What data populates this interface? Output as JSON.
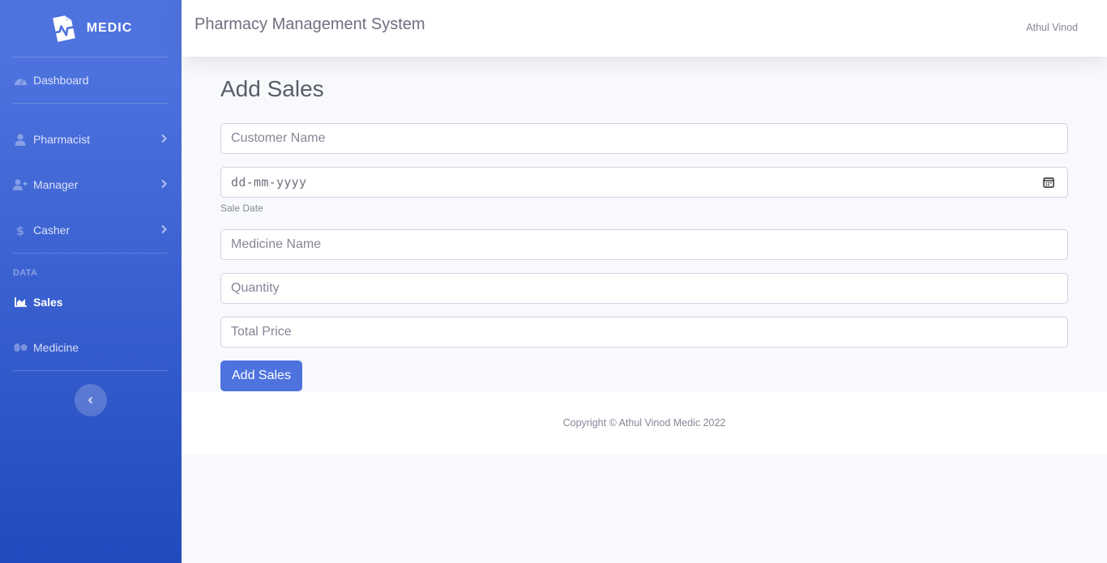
{
  "brand": {
    "name": "MEDIC"
  },
  "sidebar": {
    "items": [
      {
        "label": "Dashboard",
        "icon": "tachometer-icon"
      },
      {
        "label": "Pharmacist",
        "icon": "user-icon"
      },
      {
        "label": "Manager",
        "icon": "user-plus-icon"
      },
      {
        "label": "Casher",
        "icon": "dollar-icon"
      },
      {
        "label": "Sales",
        "icon": "area-chart-icon",
        "active": true
      },
      {
        "label": "Medicine",
        "icon": "pills-icon"
      }
    ],
    "heading": "DATA"
  },
  "topbar": {
    "title": "Pharmacy Management System",
    "user": "Athul Vinod"
  },
  "form": {
    "title": "Add Sales",
    "customer_placeholder": "Customer Name",
    "date_placeholder": "dd-mm-yyyy",
    "date_help": "Sale Date",
    "medicine_placeholder": "Medicine Name",
    "quantity_placeholder": "Quantity",
    "total_placeholder": "Total Price",
    "submit_label": "Add Sales"
  },
  "footer": {
    "text": "Copyright © Athul Vinod Medic 2022"
  },
  "colors": {
    "primary": "#4e73df",
    "primary_dark": "#224abe"
  }
}
